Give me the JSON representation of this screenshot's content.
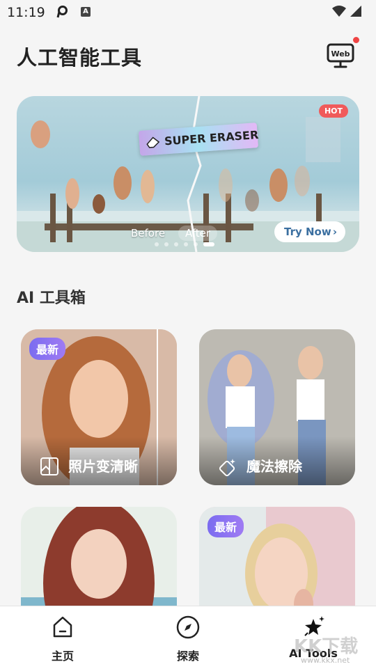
{
  "status_bar": {
    "time": "11:19"
  },
  "header": {
    "title": "人工智能工具",
    "web_button_label": "Web"
  },
  "banner": {
    "tag_text": "SUPER ERASER",
    "hot_badge": "HOT",
    "before_label": "Before",
    "after_label": "After",
    "cta_label": "Try Now",
    "slide_count": 6,
    "active_slide": 6
  },
  "section": {
    "title": "AI 工具箱"
  },
  "tools": [
    {
      "label": "照片变清晰",
      "badge": "最新"
    },
    {
      "label": "魔法擦除",
      "badge": ""
    },
    {
      "label": "",
      "badge": ""
    },
    {
      "label": "",
      "badge": "最新"
    }
  ],
  "tab_bar": {
    "tabs": [
      {
        "label": "主页",
        "icon": "home-icon"
      },
      {
        "label": "探索",
        "icon": "compass-icon"
      },
      {
        "label": "AI Tools",
        "icon": "sparkle-star-icon"
      }
    ]
  },
  "watermark": {
    "text": "KK下载",
    "url": "www.kkx.net"
  },
  "colors": {
    "accent_purple": "#7b6cf0",
    "hot_red": "#f05a5a",
    "notification_dot": "#ef4444"
  }
}
